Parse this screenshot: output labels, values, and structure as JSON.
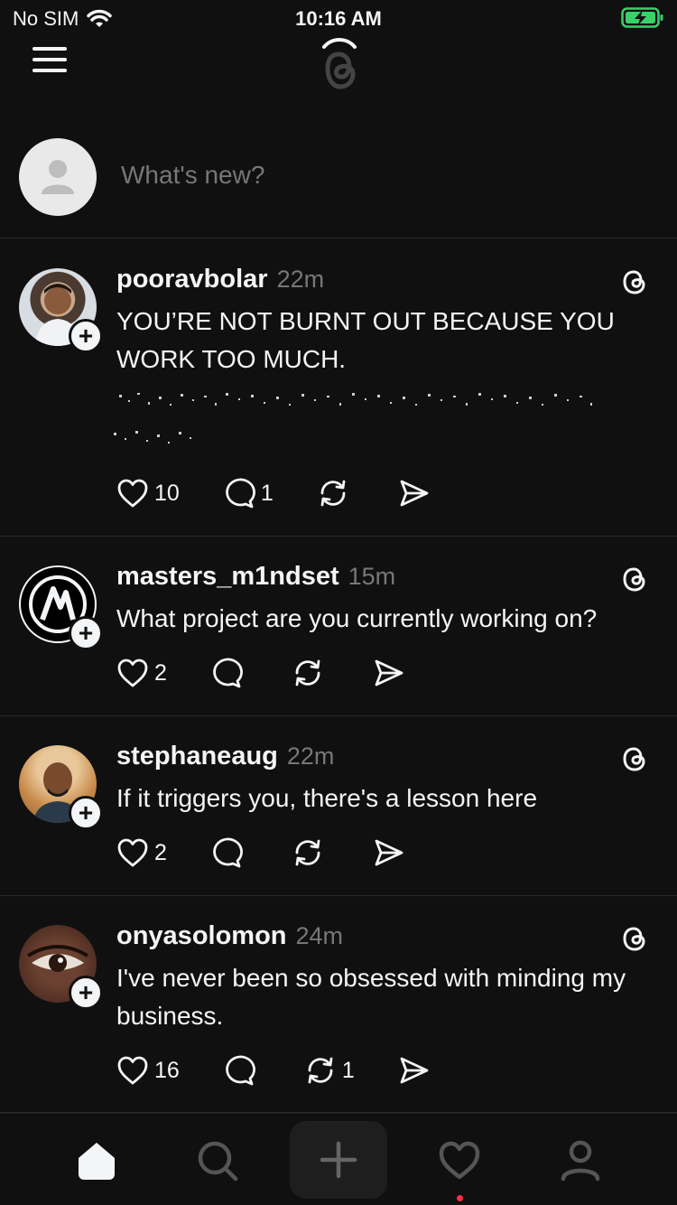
{
  "status": {
    "carrier": "No SIM",
    "time": "10:16 AM"
  },
  "composer": {
    "placeholder": "What's new?"
  },
  "posts": [
    {
      "username": "pooravbolar",
      "time": "22m",
      "text": "YOU’RE NOT BURNT OUT BECAUSE YOU WORK TOO MUCH.",
      "likes": "10",
      "replies": "1",
      "reposts": ""
    },
    {
      "username": "masters_m1ndset",
      "time": "15m",
      "text": "What project are you currently working on?",
      "likes": "2",
      "replies": "",
      "reposts": ""
    },
    {
      "username": "stephaneaug",
      "time": "22m",
      "text": "If it triggers you, there's a lesson here",
      "likes": "2",
      "replies": "",
      "reposts": ""
    },
    {
      "username": "onyasolomon",
      "time": "24m",
      "text": "I've never been so obsessed with minding my business.",
      "likes": "16",
      "replies": "",
      "reposts": "1"
    }
  ],
  "nav": {
    "items": [
      "home-icon",
      "search-icon",
      "create-icon",
      "activity-icon",
      "profile-icon"
    ]
  },
  "colors": {
    "background": "#101010",
    "text": "#f3f5f7",
    "muted": "#777777",
    "notification": "#ff3040"
  }
}
